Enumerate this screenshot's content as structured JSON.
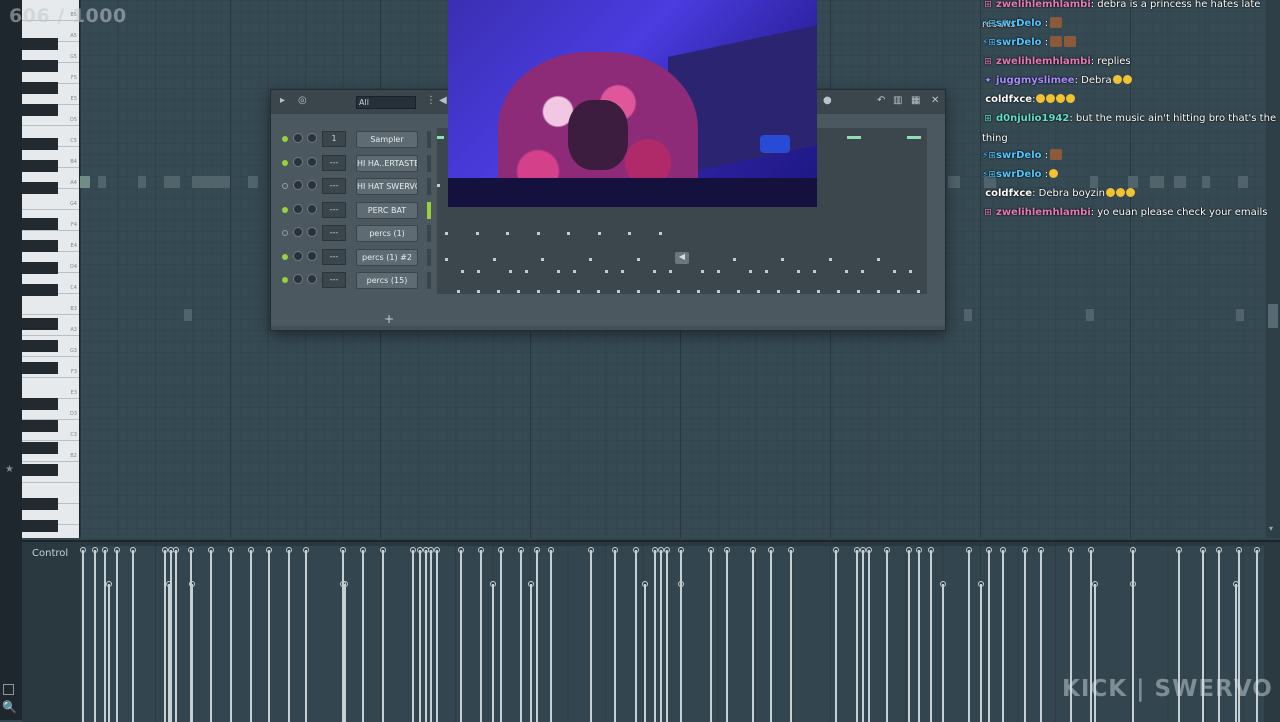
{
  "counter": {
    "text": "606 / 1000"
  },
  "channel_rack": {
    "filter_value": "All",
    "add_label": "+",
    "channels": [
      {
        "mixer": "1",
        "name": "Sampler",
        "led_on": true,
        "selected": false
      },
      {
        "mixer": "---",
        "name": "HI HA..ERTASTE",
        "led_on": true,
        "selected": false
      },
      {
        "mixer": "---",
        "name": "HI HAT SWERVO",
        "led_on": false,
        "selected": false
      },
      {
        "mixer": "---",
        "name": "PERC BAT",
        "led_on": true,
        "selected": true
      },
      {
        "mixer": "---",
        "name": "percs (1)",
        "led_on": false,
        "selected": false
      },
      {
        "mixer": "---",
        "name": "percs (1) #2",
        "led_on": true,
        "selected": false
      },
      {
        "mixer": "---",
        "name": "percs (15)",
        "led_on": true,
        "selected": false
      }
    ]
  },
  "piano": {
    "labels": [
      "B5",
      "A5",
      "G5",
      "F5",
      "E5",
      "D5",
      "C5",
      "B4",
      "A4",
      "G4",
      "F4",
      "E4",
      "D4",
      "C4",
      "B3",
      "A3",
      "G3",
      "F3",
      "E3",
      "D3",
      "C3",
      "B2"
    ]
  },
  "control_lane": {
    "label": "Control"
  },
  "chat": {
    "messages": [
      {
        "user": "zwelihlemhlambi",
        "color": "#e67ab8",
        "badge": "⊞",
        "text": ": debra is a princess he hates late results",
        "emotes": 0,
        "emojis": 0
      },
      {
        "user": "swrDelo",
        "color": "#51c7ff",
        "badge": "⚡⊞",
        "text": " :",
        "emotes": 1,
        "emojis": 0
      },
      {
        "user": "swrDelo",
        "color": "#51c7ff",
        "badge": "⚡⊞",
        "text": " :",
        "emotes": 2,
        "emojis": 0
      },
      {
        "user": "zwelihlemhlambi",
        "color": "#e67ab8",
        "badge": "⊞",
        "text": ": replies",
        "emotes": 0,
        "emojis": 0
      },
      {
        "user": "juggmyslimee",
        "color": "#a88cff",
        "badge": "✦",
        "text": ": Debra",
        "emotes": 0,
        "emojis": 2
      },
      {
        "user": "coldfxce",
        "color": "#ffffff",
        "badge": "",
        "text": ":",
        "emotes": 0,
        "emojis": 4
      },
      {
        "user": "d0njulio1942",
        "color": "#62e0c6",
        "badge": "⊞",
        "text": ": but the music ain't hitting bro that's the thing",
        "emotes": 0,
        "emojis": 0
      },
      {
        "user": "swrDelo",
        "color": "#51c7ff",
        "badge": "⚡⊞",
        "text": " :",
        "emotes": 1,
        "emojis": 0
      },
      {
        "user": "swrDelo",
        "color": "#51c7ff",
        "badge": "⚡⊞",
        "text": " :",
        "emotes": 0,
        "emojis": 1
      },
      {
        "user": "coldfxce",
        "color": "#ffffff",
        "badge": "",
        "text": ": Debra boyzin",
        "emotes": 0,
        "emojis": 3
      },
      {
        "user": "zwelihlemhlambi",
        "color": "#e67ab8",
        "badge": "⊞",
        "text": ": yo euan please check your emails",
        "emotes": 0,
        "emojis": 0
      }
    ]
  },
  "watermark": {
    "text": "KICK | SWERVO"
  },
  "icons": {
    "play": "play-icon",
    "target": "target-icon",
    "speaker": "speaker-icon",
    "undo": "undo-icon",
    "graph": "graph-icon",
    "piano": "piano-icon",
    "close": "close-icon"
  }
}
